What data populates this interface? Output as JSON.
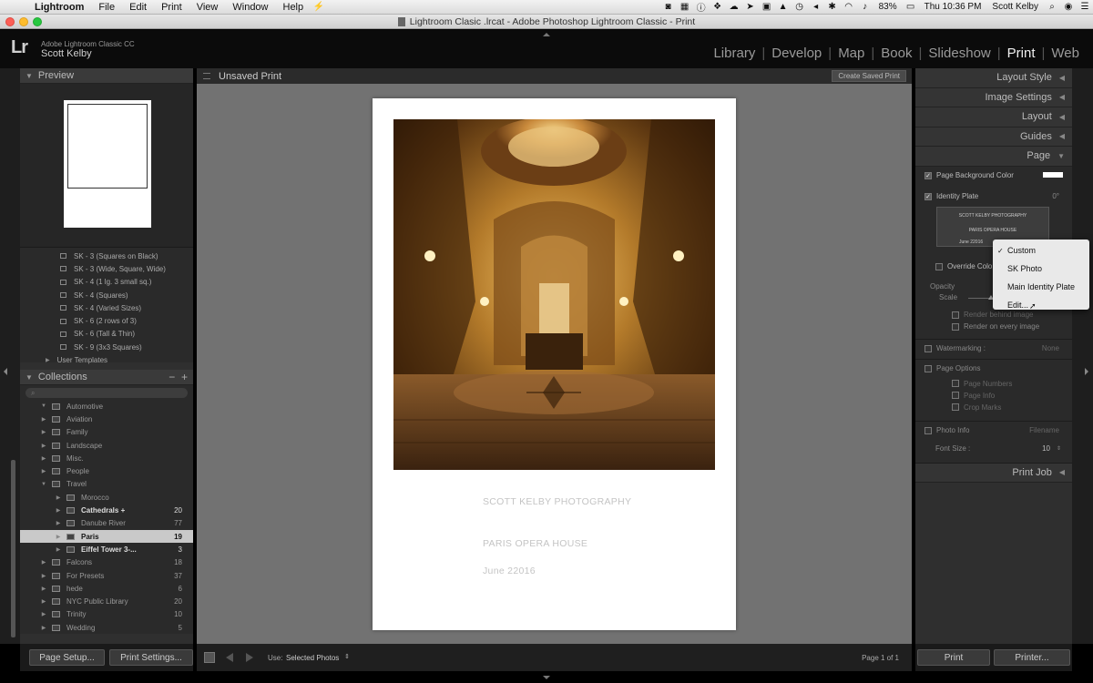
{
  "menubar": {
    "apple_glyph": "",
    "items": [
      "Lightroom",
      "File",
      "Edit",
      "Print",
      "View",
      "Window",
      "Help"
    ],
    "battery": "83%",
    "clock": "Thu 10:36 PM",
    "user": "Scott Kelby"
  },
  "window": {
    "title": "Lightroom Clasic .lrcat - Adobe Photoshop Lightroom Classic - Print"
  },
  "identity": {
    "logo": "Lr",
    "product": "Adobe Lightroom Classic CC",
    "user": "Scott Kelby"
  },
  "modules": [
    "Library",
    "Develop",
    "Map",
    "Book",
    "Slideshow",
    "Print",
    "Web"
  ],
  "active_module": "Print",
  "left_panel": {
    "preview_label": "Preview",
    "templates": [
      "SK - 3 (Squares on Black)",
      "SK - 3 (Wide, Square, Wide)",
      "SK - 4 (1 lg. 3 small sq.)",
      "SK - 4 (Squares)",
      "SK - 4 (Varied Sizes)",
      "SK - 6 (2 rows of 3)",
      "SK - 6 (Tall & Thin)",
      "SK - 9 (3x3 Squares)"
    ],
    "user_templates": "User Templates",
    "collections_label": "Collections",
    "collections": [
      {
        "label": "Automotive",
        "count": "",
        "level": 0,
        "tri": "▼"
      },
      {
        "label": "Aviation",
        "count": "",
        "level": 0,
        "tri": "▶"
      },
      {
        "label": "Family",
        "count": "",
        "level": 0,
        "tri": "▶"
      },
      {
        "label": "Landscape",
        "count": "",
        "level": 0,
        "tri": "▶"
      },
      {
        "label": "Misc.",
        "count": "",
        "level": 0,
        "tri": "▶"
      },
      {
        "label": "People",
        "count": "",
        "level": 0,
        "tri": "▶"
      },
      {
        "label": "Travel",
        "count": "",
        "level": 0,
        "tri": "▼"
      },
      {
        "label": "Morocco",
        "count": "",
        "level": 1,
        "tri": "▶"
      },
      {
        "label": "Cathedrals +",
        "count": "20",
        "level": 1,
        "tri": "▶",
        "bright": true
      },
      {
        "label": "Danube River",
        "count": "77",
        "level": 1,
        "tri": "▶"
      },
      {
        "label": "Paris",
        "count": "19",
        "level": 1,
        "tri": "▶",
        "selected": true
      },
      {
        "label": "Eiffel Tower 3-...",
        "count": "3",
        "level": 1,
        "tri": "▶",
        "bright": true
      },
      {
        "label": "Falcons",
        "count": "18",
        "level": 0,
        "tri": "▶"
      },
      {
        "label": "For Presets",
        "count": "37",
        "level": 0,
        "tri": "▶"
      },
      {
        "label": "hede",
        "count": "6",
        "level": 0,
        "tri": "▶"
      },
      {
        "label": "NYC Public Library",
        "count": "20",
        "level": 0,
        "tri": "▶"
      },
      {
        "label": "Trinity",
        "count": "10",
        "level": 0,
        "tri": "▶"
      },
      {
        "label": "Wedding",
        "count": "5",
        "level": 0,
        "tri": "▶"
      }
    ],
    "page_setup": "Page Setup...",
    "print_settings": "Print Settings..."
  },
  "center": {
    "title": "Unsaved Print",
    "create_saved_print": "Create Saved Print",
    "plate_line1": "SCOTT KELBY PHOTOGRAPHY",
    "plate_line2": "PARIS OPERA HOUSE",
    "plate_line3": "June 22016",
    "use_label": "Use:",
    "use_value": "Selected Photos",
    "page_info": "Page 1 of 1"
  },
  "right_panel": {
    "headers": [
      "Layout Style",
      "Image Settings",
      "Layout",
      "Guides",
      "Page"
    ],
    "page_bg_color": "Page Background Color",
    "identity_plate": "Identity Plate",
    "angle": "0°",
    "plate_preview": [
      "SCOTT KELBY PHOTOGRAPHY",
      "PARIS OPERA HOUSE",
      "June 22016"
    ],
    "override_color": "Override Colo",
    "opacity": "Opacity",
    "scale": "Scale",
    "render_behind": "Render behind image",
    "render_every": "Render on every image",
    "watermarking": "Watermarking :",
    "watermark_value": "None",
    "page_options": "Page Options",
    "page_numbers": "Page Numbers",
    "page_info": "Page Info",
    "crop_marks": "Crop Marks",
    "photo_info": "Photo Info",
    "photo_info_value": "Filename",
    "font_size": "Font Size :",
    "font_size_value": "10",
    "print_job": "Print Job",
    "print_btn": "Print",
    "printer_btn": "Printer..."
  },
  "dropdown": {
    "items": [
      "Custom",
      "SK Photo",
      "Main Identity Plate",
      "Edit..."
    ],
    "checked": "Custom"
  },
  "colors": {
    "canvas": "#727272",
    "panel": "#2f2f2f",
    "selected_row": "#c9c9c9"
  }
}
